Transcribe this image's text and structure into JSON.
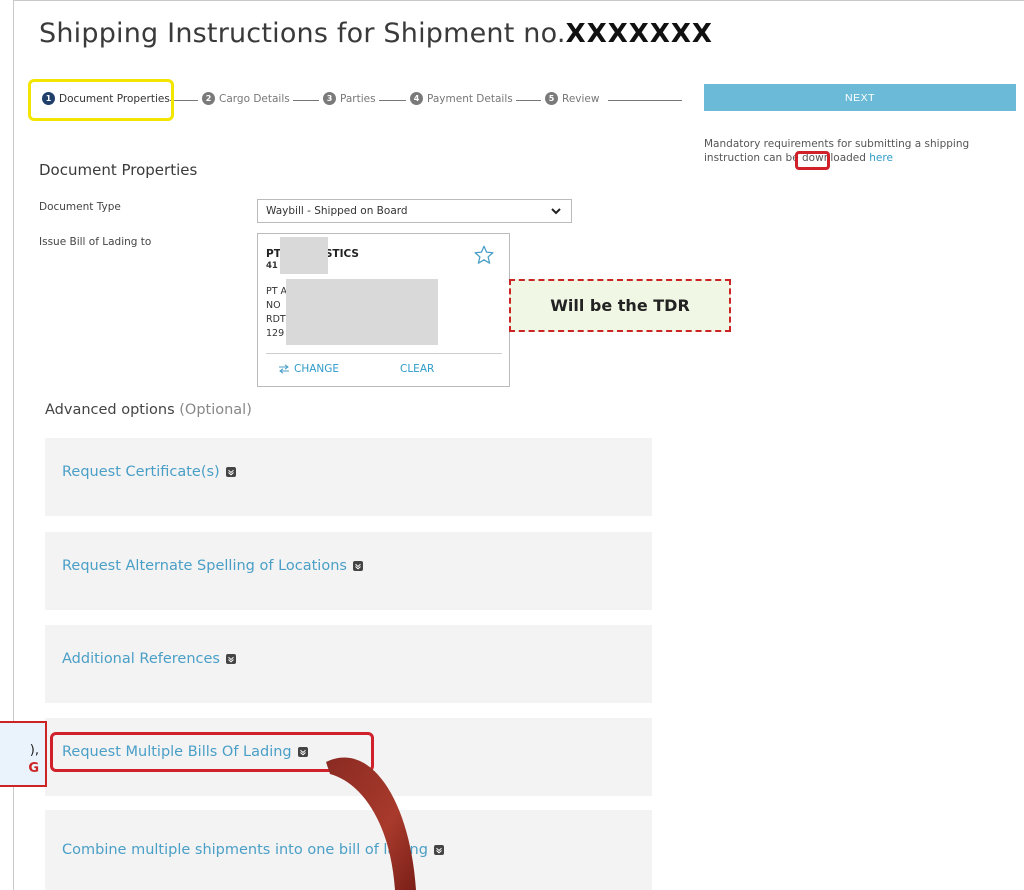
{
  "title": {
    "prefix": "Shipping Instructions for Shipment no.",
    "shipment_no": "XXXXXXX"
  },
  "stepper": {
    "steps": [
      {
        "num": "1",
        "label": "Document Properties",
        "active": true
      },
      {
        "num": "2",
        "label": "Cargo Details",
        "active": false
      },
      {
        "num": "3",
        "label": "Parties",
        "active": false
      },
      {
        "num": "4",
        "label": "Payment Details",
        "active": false
      },
      {
        "num": "5",
        "label": "Review",
        "active": false
      }
    ]
  },
  "next_button": "NEXT",
  "mandatory": {
    "text": "Mandatory requirements for submitting a shipping instruction can be downloaded",
    "link": "here"
  },
  "section_title": "Document Properties",
  "document_type": {
    "label": "Document Type",
    "value": "Waybill - Shipped on Board"
  },
  "issue_bl": {
    "label": "Issue Bill of Lading to",
    "party_name_a": "PT",
    "party_name_b": "STICS",
    "party_sub": "41",
    "address_lines": [
      "PT A",
      "NO",
      "RDT",
      "129"
    ],
    "change_label": "CHANGE",
    "clear_label": "CLEAR"
  },
  "tdr_callout": "Will be the TDR",
  "advanced": {
    "label": "Advanced options",
    "optional": "(Optional)"
  },
  "accordions": [
    "Request Certificate(s)",
    "Request Alternate Spelling of Locations",
    "Additional References",
    "Request Multiple Bills Of Lading",
    "Combine multiple shipments into one bill of lading"
  ],
  "left_callout": {
    "line1": "),",
    "line2": "G"
  },
  "colors": {
    "accent": "#4a9fc7",
    "next_button": "#6bbbd8",
    "highlight_red": "#d0202a",
    "highlight_yellow": "#f2e600",
    "active_step": "#1f3f6a"
  }
}
